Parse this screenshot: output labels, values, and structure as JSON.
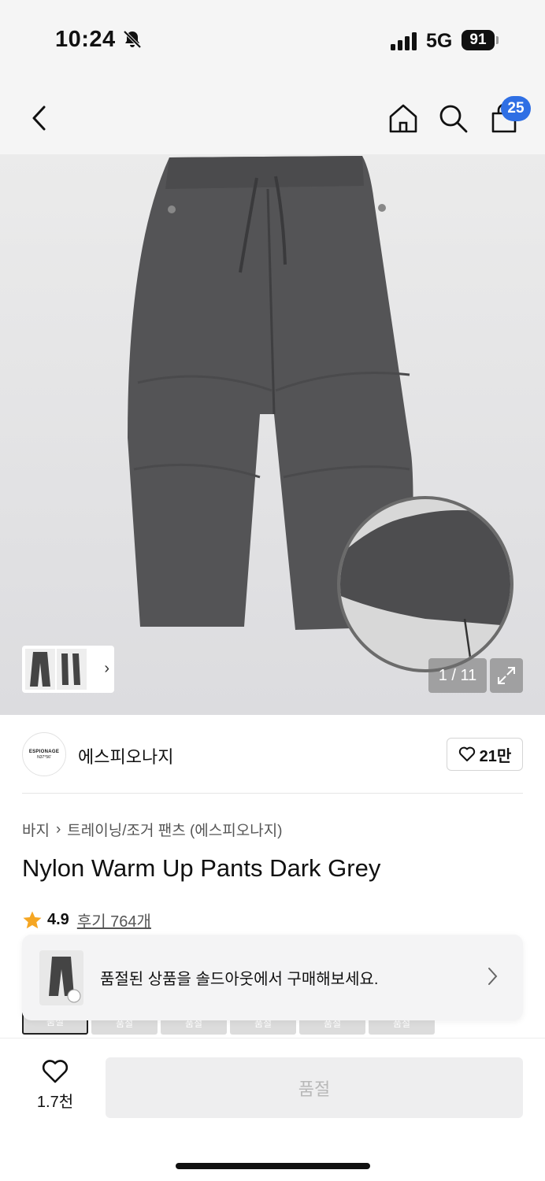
{
  "status_bar": {
    "time": "10:24",
    "network": "5G",
    "battery": "91"
  },
  "nav": {
    "cart_count": "25",
    "icons": [
      "back-icon",
      "home-icon",
      "search-icon",
      "cart-icon"
    ]
  },
  "gallery": {
    "counter": "1 / 11"
  },
  "brand": {
    "logo_line1": "ESPIONAGE",
    "logo_line2": "N37°56'",
    "name": "에스피오나지",
    "likes": "21만"
  },
  "breadcrumb": {
    "category": "바지",
    "subcategory": "트레이닝/조거 팬츠 (에스피오나지)"
  },
  "product": {
    "title": "Nylon Warm Up Pants Dark Grey",
    "rating": "4.9",
    "reviews": "후기 764개"
  },
  "swatches": [
    "품절",
    "품절",
    "품절",
    "품절",
    "품절",
    "품절"
  ],
  "soldout_banner": {
    "text": "품절된 상품을 솔드아웃에서 구매해보세요."
  },
  "bottom_bar": {
    "wish_count": "1.7천",
    "buy_label": "품절"
  },
  "colors": {
    "accent": "#2f6fe4",
    "star": "#f5a623",
    "disabled_text": "#b8b8b8"
  }
}
